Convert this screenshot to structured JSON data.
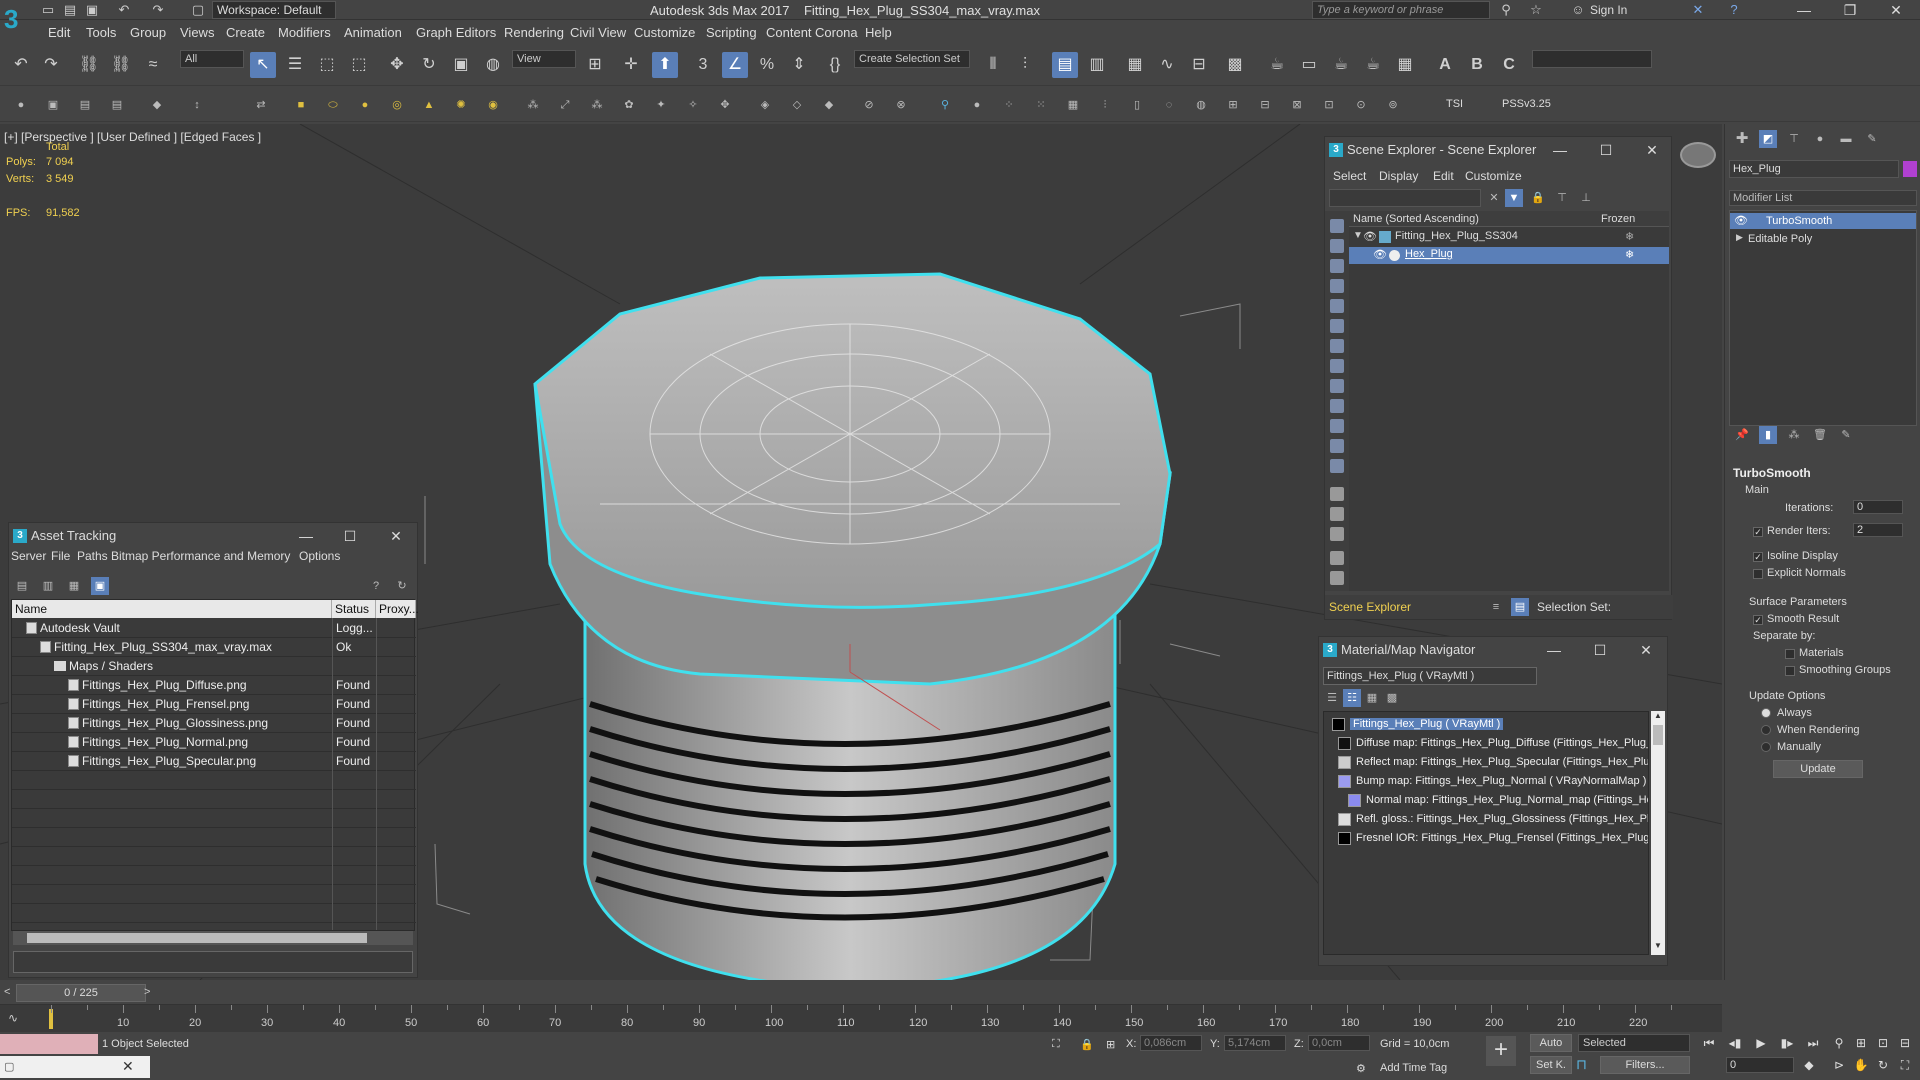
{
  "titlebar": {
    "app": "Autodesk 3ds Max 2017",
    "file": "Fitting_Hex_Plug_SS304_max_vray.max",
    "workspace": "Workspace: Default",
    "search_placeholder": "Type a keyword or phrase",
    "sign_in": "Sign In"
  },
  "menu": [
    "Edit",
    "Tools",
    "Group",
    "Views",
    "Create",
    "Modifiers",
    "Animation",
    "Graph Editors",
    "Rendering",
    "Civil View",
    "Customize",
    "Scripting",
    "Content",
    "Corona",
    "Help"
  ],
  "toolbar": {
    "filter": "All",
    "view": "View",
    "selection_set": "Create Selection Set",
    "tsi": "TSI",
    "pss": "PSSv3.25"
  },
  "viewport": {
    "label": "[+] [Perspective ] [User Defined ] [Edged Faces ]",
    "total": "Total",
    "polys_label": "Polys:",
    "polys": "7 094",
    "verts_label": "Verts:",
    "verts": "3 549",
    "fps_label": "FPS:",
    "fps": "91,582"
  },
  "scene_explorer": {
    "title": "Scene Explorer - Scene Explorer",
    "menu": [
      "Select",
      "Display",
      "Edit",
      "Customize"
    ],
    "col_name": "Name (Sorted Ascending)",
    "col_frozen": "Frozen",
    "items": [
      "Fitting_Hex_Plug_SS304",
      "Hex_Plug"
    ],
    "footer_label": "Scene Explorer",
    "selection_set": "Selection Set:"
  },
  "asset_tracking": {
    "title": "Asset Tracking",
    "menu": [
      "Server",
      "File",
      "Paths",
      "Bitmap Performance and Memory",
      "Options"
    ],
    "columns": [
      "Name",
      "Status",
      "Proxy..."
    ],
    "rows": [
      {
        "name": "Autodesk Vault",
        "status": "Logg...",
        "indent": 0,
        "type": "vault"
      },
      {
        "name": "Fitting_Hex_Plug_SS304_max_vray.max",
        "status": "Ok",
        "indent": 1,
        "type": "max"
      },
      {
        "name": "Maps / Shaders",
        "status": "",
        "indent": 2,
        "type": "folder"
      },
      {
        "name": "Fittings_Hex_Plug_Diffuse.png",
        "status": "Found",
        "indent": 3,
        "type": "file"
      },
      {
        "name": "Fittings_Hex_Plug_Frensel.png",
        "status": "Found",
        "indent": 3,
        "type": "file"
      },
      {
        "name": "Fittings_Hex_Plug_Glossiness.png",
        "status": "Found",
        "indent": 3,
        "type": "file"
      },
      {
        "name": "Fittings_Hex_Plug_Normal.png",
        "status": "Found",
        "indent": 3,
        "type": "file"
      },
      {
        "name": "Fittings_Hex_Plug_Specular.png",
        "status": "Found",
        "indent": 3,
        "type": "file"
      }
    ]
  },
  "material_navigator": {
    "title": "Material/Map Navigator",
    "current": "Fittings_Hex_Plug  ( VRayMtl )",
    "items": [
      {
        "label": "Fittings_Hex_Plug  ( VRayMtl )",
        "swatch": "#000000",
        "selected": true
      },
      {
        "label": "Diffuse map: Fittings_Hex_Plug_Diffuse (Fittings_Hex_Plug_D",
        "swatch": "#111111"
      },
      {
        "label": "Reflect map: Fittings_Hex_Plug_Specular (Fittings_Hex_Plug_",
        "swatch": "#cccccc"
      },
      {
        "label": "Bump map: Fittings_Hex_Plug_Normal  ( VRayNormalMap )",
        "swatch": "#9b9bf0"
      },
      {
        "label": "Normal map: Fittings_Hex_Plug_Normal_map (Fittings_Hex_",
        "swatch": "#8b8bef"
      },
      {
        "label": "Refl. gloss.: Fittings_Hex_Plug_Glossiness (Fittings_Hex_Plug_",
        "swatch": "#dddddd"
      },
      {
        "label": "Fresnel IOR: Fittings_Hex_Plug_Frensel (Fittings_Hex_Plug_F",
        "swatch": "#000000"
      }
    ]
  },
  "command_panel": {
    "object_name": "Hex_Plug",
    "modifier_list": "Modifier List",
    "stack": [
      "TurboSmooth",
      "Editable Poly"
    ],
    "rollout": "TurboSmooth",
    "main": "Main",
    "iterations_label": "Iterations:",
    "iterations": "0",
    "render_iters_label": "Render Iters:",
    "render_iters": "2",
    "isoline": "Isoline Display",
    "explicit_normals": "Explicit Normals",
    "surface_params": "Surface Parameters",
    "smooth_result": "Smooth Result",
    "separate_by": "Separate by:",
    "materials": "Materials",
    "smoothing_groups": "Smoothing Groups",
    "update_options": "Update Options",
    "always": "Always",
    "when_rendering": "When Rendering",
    "manually": "Manually",
    "update": "Update"
  },
  "timeline": {
    "frame": "0 / 225",
    "ticks": [
      "10",
      "20",
      "30",
      "40",
      "50",
      "60",
      "70",
      "80",
      "90",
      "100",
      "110",
      "120",
      "130",
      "140",
      "150",
      "160",
      "170",
      "180",
      "190",
      "200",
      "210",
      "220"
    ]
  },
  "status": {
    "selected": "1 Object Selected",
    "x_label": "X:",
    "x": "0,086cm",
    "y_label": "Y:",
    "y": "5,174cm",
    "z_label": "Z:",
    "z": "0,0cm",
    "grid": "Grid = 10,0cm",
    "auto": "Auto",
    "set_k": "Set K.",
    "selected_dd": "Selected",
    "filters": "Filters...",
    "add_time_tag": "Add Time Tag",
    "frame_field": "0"
  }
}
